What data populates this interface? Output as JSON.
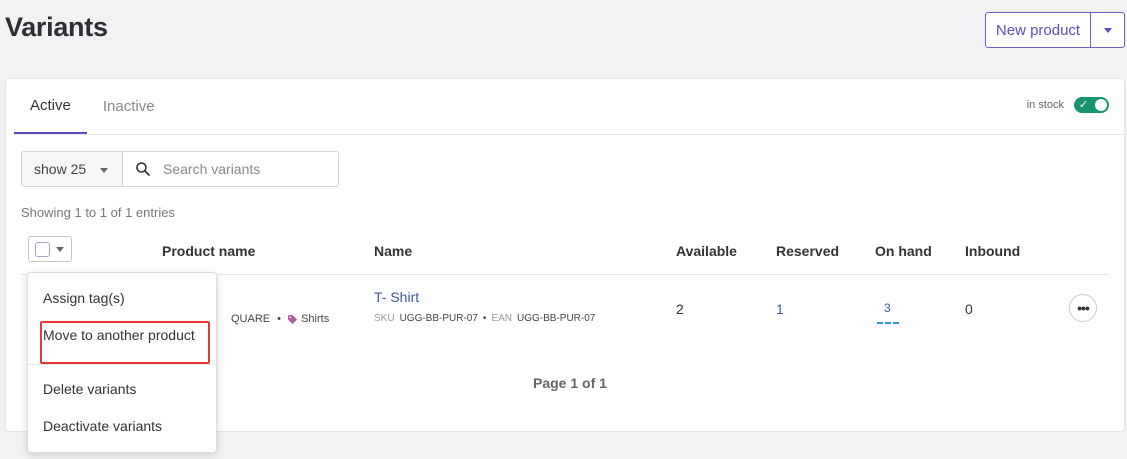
{
  "page": {
    "title": "Variants"
  },
  "header": {
    "new_product_label": "New product"
  },
  "tabs": [
    {
      "label": "Active"
    },
    {
      "label": "Inactive"
    }
  ],
  "filters": {
    "in_stock_label": "in stock",
    "show_label": "show 25",
    "search_placeholder": "Search variants"
  },
  "table": {
    "showing_text": "Showing 1 to 1 of 1 entries",
    "headers": [
      "Product name",
      "Name",
      "Available",
      "Reserved",
      "On hand",
      "Inbound"
    ],
    "rows": [
      {
        "product_meta_prefix": "QUARE",
        "product_tag": "Shirts",
        "variant_name": "T- Shirt",
        "sku_label": "SKU",
        "sku": "UGG-BB-PUR-07",
        "ean_label": "EAN",
        "ean": "UGG-BB-PUR-07",
        "available": "2",
        "reserved": "1",
        "on_hand": "3",
        "inbound": "0"
      }
    ],
    "pagination": "Page 1 of 1"
  },
  "bulk_menu": {
    "items": [
      {
        "label": "Assign tag(s)"
      },
      {
        "label": "Move to another product"
      },
      {
        "label": "Delete variants"
      },
      {
        "label": "Deactivate variants"
      }
    ]
  },
  "colors": {
    "accent": "#5b4fc0",
    "toggle_on": "#17946f",
    "link": "#3c5a99",
    "highlight": "#e53935"
  }
}
